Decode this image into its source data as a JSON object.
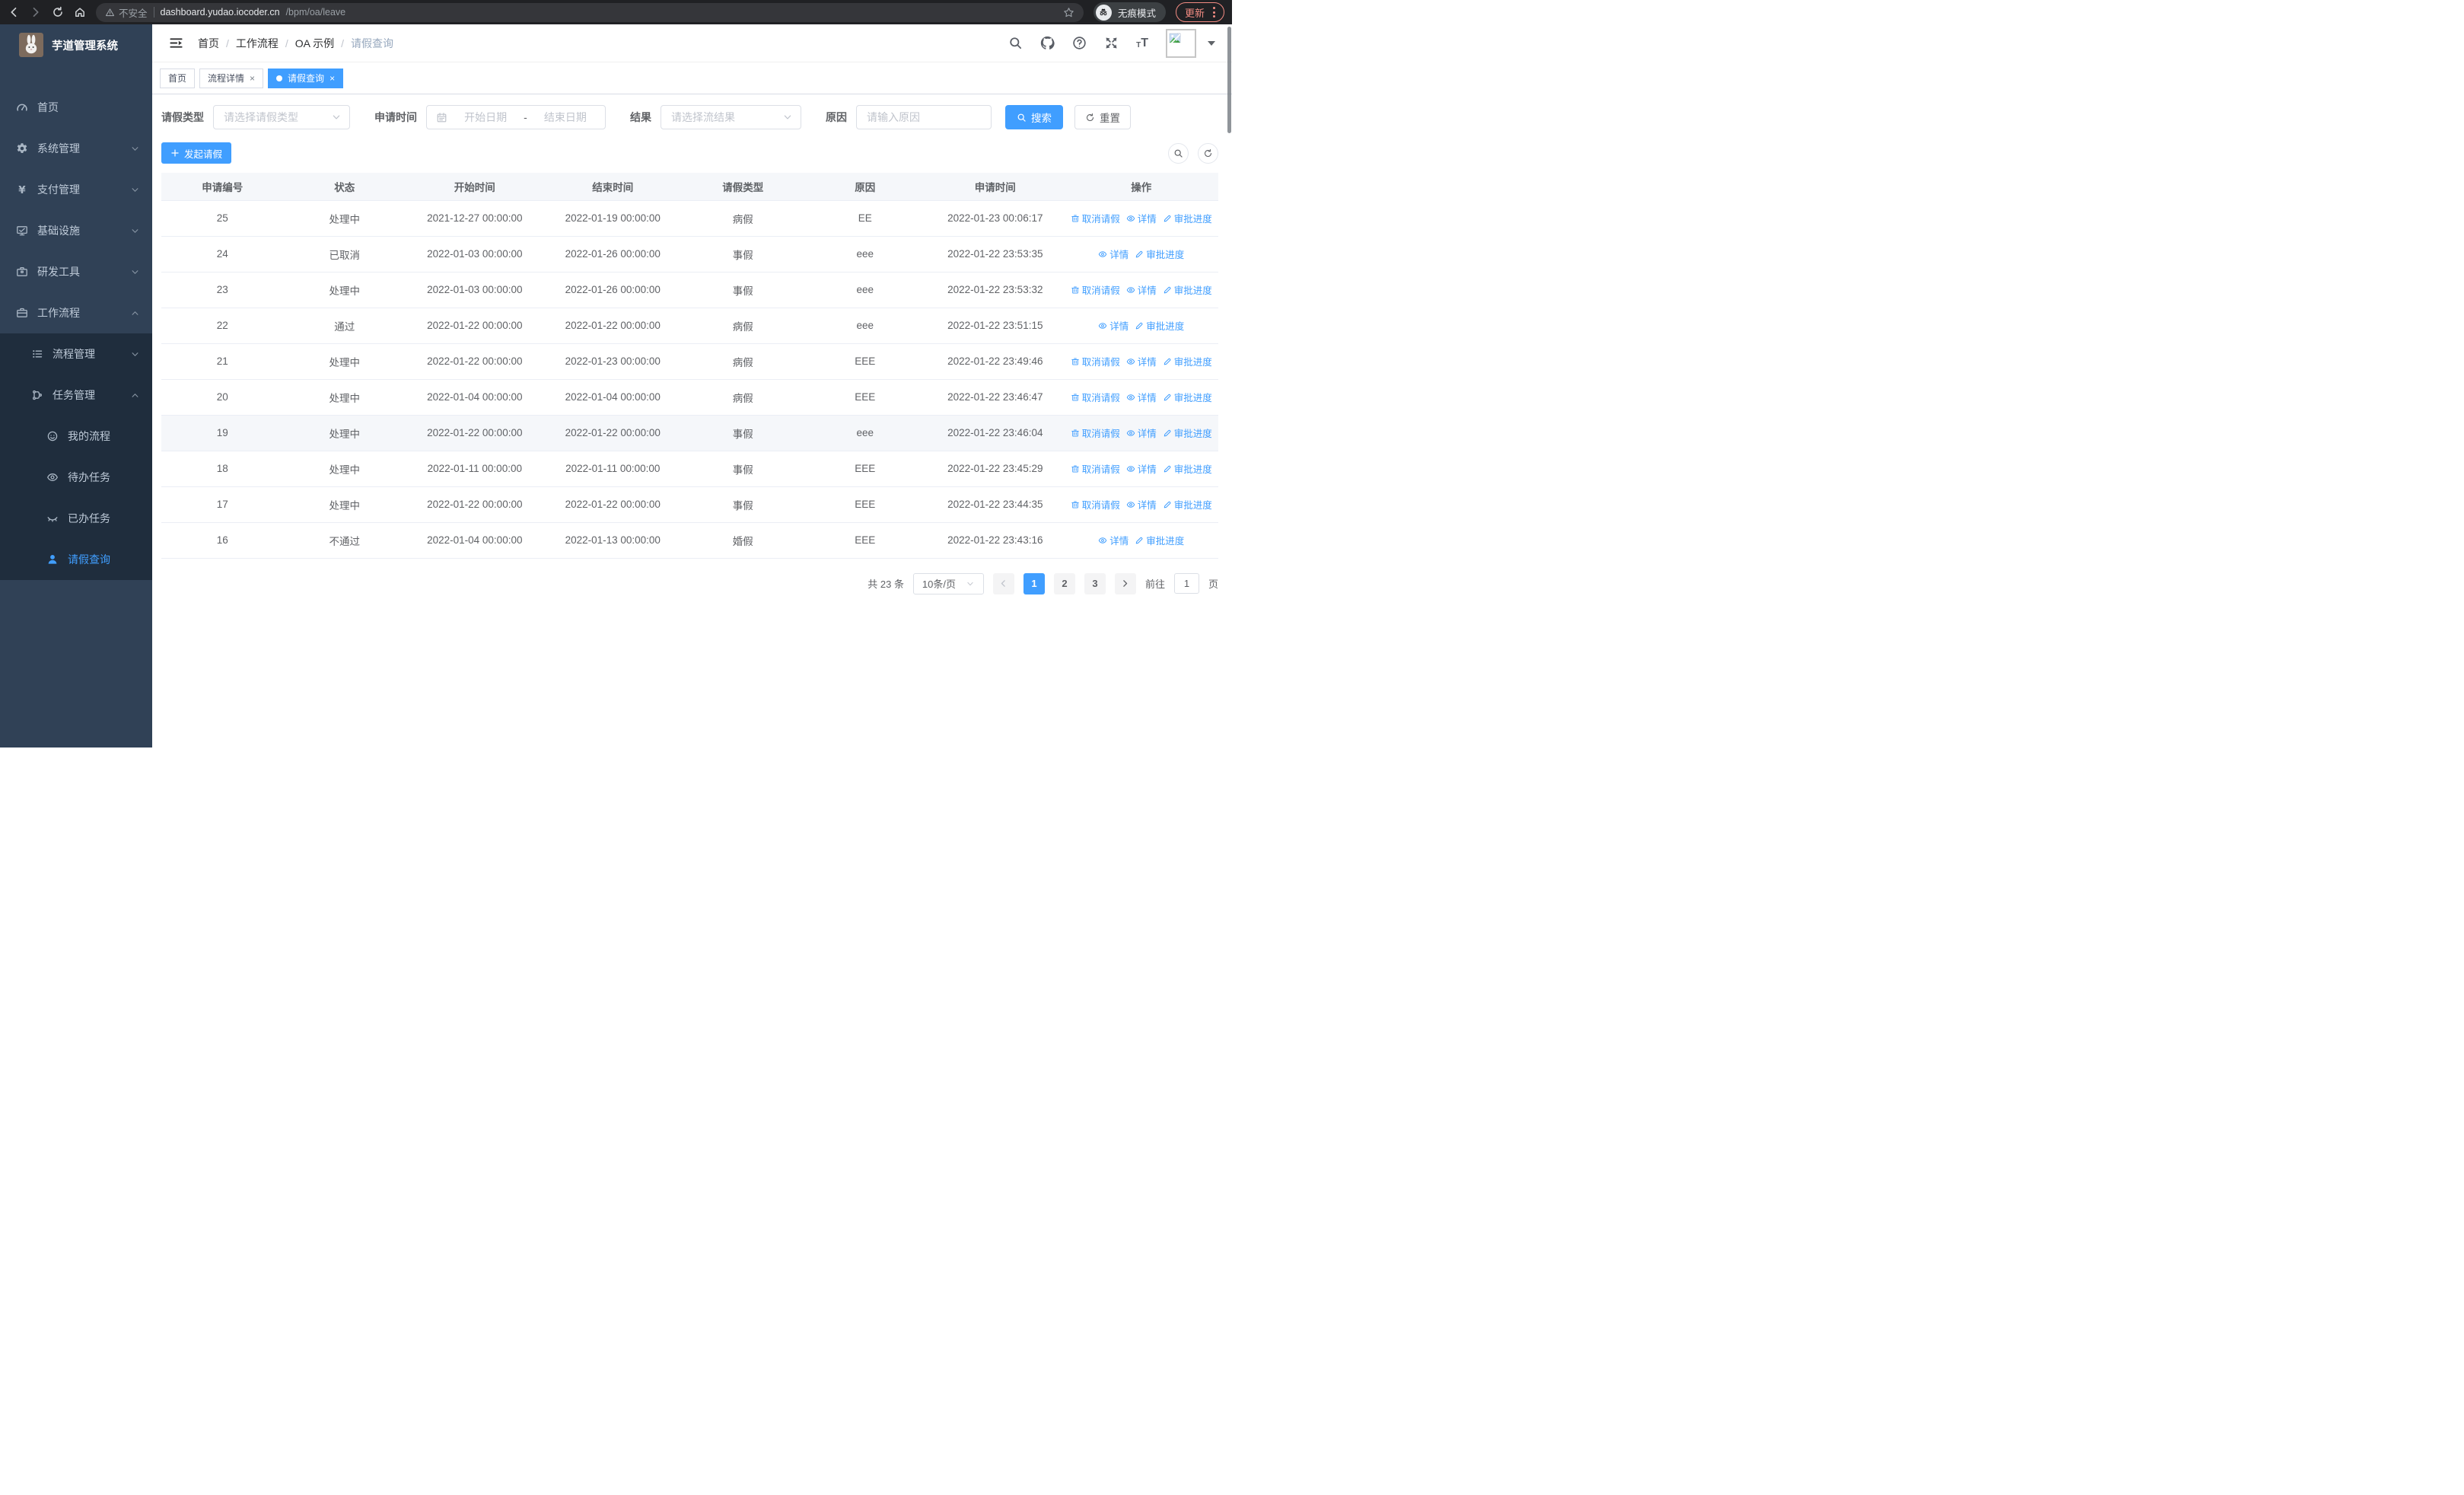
{
  "colors": {
    "accent": "#409eff",
    "sidebar_bg": "#304156",
    "submenu_bg": "#1f2d3d",
    "update_chip": "#f28b82"
  },
  "browser": {
    "security_label": "不安全",
    "url_host": "dashboard.yudao.iocoder.cn",
    "url_path": "/bpm/oa/leave",
    "incognito_label": "无痕模式",
    "update_label": "更新"
  },
  "app_title": "芋道管理系统",
  "sidebar": {
    "items": [
      {
        "id": "home",
        "label": "首页",
        "icon": "dashboard-icon",
        "level": 1,
        "chevron": null,
        "dark": false,
        "active": false
      },
      {
        "id": "system-mgmt",
        "label": "系统管理",
        "icon": "gear-icon",
        "level": 1,
        "chevron": "down",
        "dark": false,
        "active": false
      },
      {
        "id": "pay-mgmt",
        "label": "支付管理",
        "icon": "yen-icon",
        "level": 1,
        "chevron": "down",
        "dark": false,
        "active": false
      },
      {
        "id": "infra",
        "label": "基础设施",
        "icon": "monitor-icon",
        "level": 1,
        "chevron": "down",
        "dark": false,
        "active": false
      },
      {
        "id": "dev-tools",
        "label": "研发工具",
        "icon": "toolbox-icon",
        "level": 1,
        "chevron": "down",
        "dark": false,
        "active": false
      },
      {
        "id": "workflow",
        "label": "工作流程",
        "icon": "briefcase-icon",
        "level": 1,
        "chevron": "up",
        "dark": false,
        "active": false
      },
      {
        "id": "process-mgmt",
        "label": "流程管理",
        "icon": "tree-list-icon",
        "level": 2,
        "chevron": "down",
        "dark": true,
        "active": false
      },
      {
        "id": "task-mgmt",
        "label": "任务管理",
        "icon": "flow-icon",
        "level": 2,
        "chevron": "up",
        "dark": true,
        "active": false
      },
      {
        "id": "my-process",
        "label": "我的流程",
        "icon": "face-icon",
        "level": 3,
        "chevron": null,
        "dark": true,
        "active": false
      },
      {
        "id": "todo-task",
        "label": "待办任务",
        "icon": "eye-icon",
        "level": 3,
        "chevron": null,
        "dark": true,
        "active": false
      },
      {
        "id": "done-task",
        "label": "已办任务",
        "icon": "eye-closed-icon",
        "level": 3,
        "chevron": null,
        "dark": true,
        "active": false
      },
      {
        "id": "leave-query",
        "label": "请假查询",
        "icon": "user-icon",
        "level": 3,
        "chevron": null,
        "dark": true,
        "active": true
      }
    ]
  },
  "breadcrumb": {
    "0": "首页",
    "1": "工作流程",
    "2": "OA 示例",
    "3": "请假查询"
  },
  "tabs": [
    {
      "label": "首页",
      "closable": false,
      "active": false
    },
    {
      "label": "流程详情",
      "closable": true,
      "active": false
    },
    {
      "label": "请假查询",
      "closable": true,
      "active": true
    }
  ],
  "filters": {
    "leave_type": {
      "label": "请假类型",
      "placeholder": "请选择请假类型"
    },
    "apply_time": {
      "label": "申请时间",
      "start_placeholder": "开始日期",
      "separator": "-",
      "end_placeholder": "结束日期"
    },
    "result": {
      "label": "结果",
      "placeholder": "请选择流结果"
    },
    "reason": {
      "label": "原因",
      "placeholder": "请输入原因"
    },
    "search_label": "搜索",
    "reset_label": "重置"
  },
  "toolbar": {
    "create_label": "发起请假"
  },
  "table": {
    "columns": [
      "申请编号",
      "状态",
      "开始时间",
      "结束时间",
      "请假类型",
      "原因",
      "申请时间",
      "操作"
    ],
    "action_labels": {
      "cancel": "取消请假",
      "detail": "详情",
      "progress": "审批进度"
    },
    "rows": [
      {
        "id": "25",
        "status": "处理中",
        "start": "2021-12-27 00:00:00",
        "end": "2022-01-19 00:00:00",
        "type": "病假",
        "reason": "EE",
        "applied": "2022-01-23 00:06:17",
        "actions": [
          "cancel",
          "detail",
          "progress"
        ],
        "highlighted": false
      },
      {
        "id": "24",
        "status": "已取消",
        "start": "2022-01-03 00:00:00",
        "end": "2022-01-26 00:00:00",
        "type": "事假",
        "reason": "eee",
        "applied": "2022-01-22 23:53:35",
        "actions": [
          "detail",
          "progress"
        ],
        "highlighted": false
      },
      {
        "id": "23",
        "status": "处理中",
        "start": "2022-01-03 00:00:00",
        "end": "2022-01-26 00:00:00",
        "type": "事假",
        "reason": "eee",
        "applied": "2022-01-22 23:53:32",
        "actions": [
          "cancel",
          "detail",
          "progress"
        ],
        "highlighted": false
      },
      {
        "id": "22",
        "status": "通过",
        "start": "2022-01-22 00:00:00",
        "end": "2022-01-22 00:00:00",
        "type": "病假",
        "reason": "eee",
        "applied": "2022-01-22 23:51:15",
        "actions": [
          "detail",
          "progress"
        ],
        "highlighted": false
      },
      {
        "id": "21",
        "status": "处理中",
        "start": "2022-01-22 00:00:00",
        "end": "2022-01-23 00:00:00",
        "type": "病假",
        "reason": "EEE",
        "applied": "2022-01-22 23:49:46",
        "actions": [
          "cancel",
          "detail",
          "progress"
        ],
        "highlighted": false
      },
      {
        "id": "20",
        "status": "处理中",
        "start": "2022-01-04 00:00:00",
        "end": "2022-01-04 00:00:00",
        "type": "病假",
        "reason": "EEE",
        "applied": "2022-01-22 23:46:47",
        "actions": [
          "cancel",
          "detail",
          "progress"
        ],
        "highlighted": false
      },
      {
        "id": "19",
        "status": "处理中",
        "start": "2022-01-22 00:00:00",
        "end": "2022-01-22 00:00:00",
        "type": "事假",
        "reason": "eee",
        "applied": "2022-01-22 23:46:04",
        "actions": [
          "cancel",
          "detail",
          "progress"
        ],
        "highlighted": true
      },
      {
        "id": "18",
        "status": "处理中",
        "start": "2022-01-11 00:00:00",
        "end": "2022-01-11 00:00:00",
        "type": "事假",
        "reason": "EEE",
        "applied": "2022-01-22 23:45:29",
        "actions": [
          "cancel",
          "detail",
          "progress"
        ],
        "highlighted": false
      },
      {
        "id": "17",
        "status": "处理中",
        "start": "2022-01-22 00:00:00",
        "end": "2022-01-22 00:00:00",
        "type": "事假",
        "reason": "EEE",
        "applied": "2022-01-22 23:44:35",
        "actions": [
          "cancel",
          "detail",
          "progress"
        ],
        "highlighted": false
      },
      {
        "id": "16",
        "status": "不通过",
        "start": "2022-01-04 00:00:00",
        "end": "2022-01-13 00:00:00",
        "type": "婚假",
        "reason": "EEE",
        "applied": "2022-01-22 23:43:16",
        "actions": [
          "detail",
          "progress"
        ],
        "highlighted": false
      }
    ]
  },
  "pagination": {
    "total_label": "共 23 条",
    "page_size_label": "10条/页",
    "pages": [
      "1",
      "2",
      "3"
    ],
    "active_page": "1",
    "goto_label": "前往",
    "goto_value": "1",
    "page_unit": "页"
  }
}
